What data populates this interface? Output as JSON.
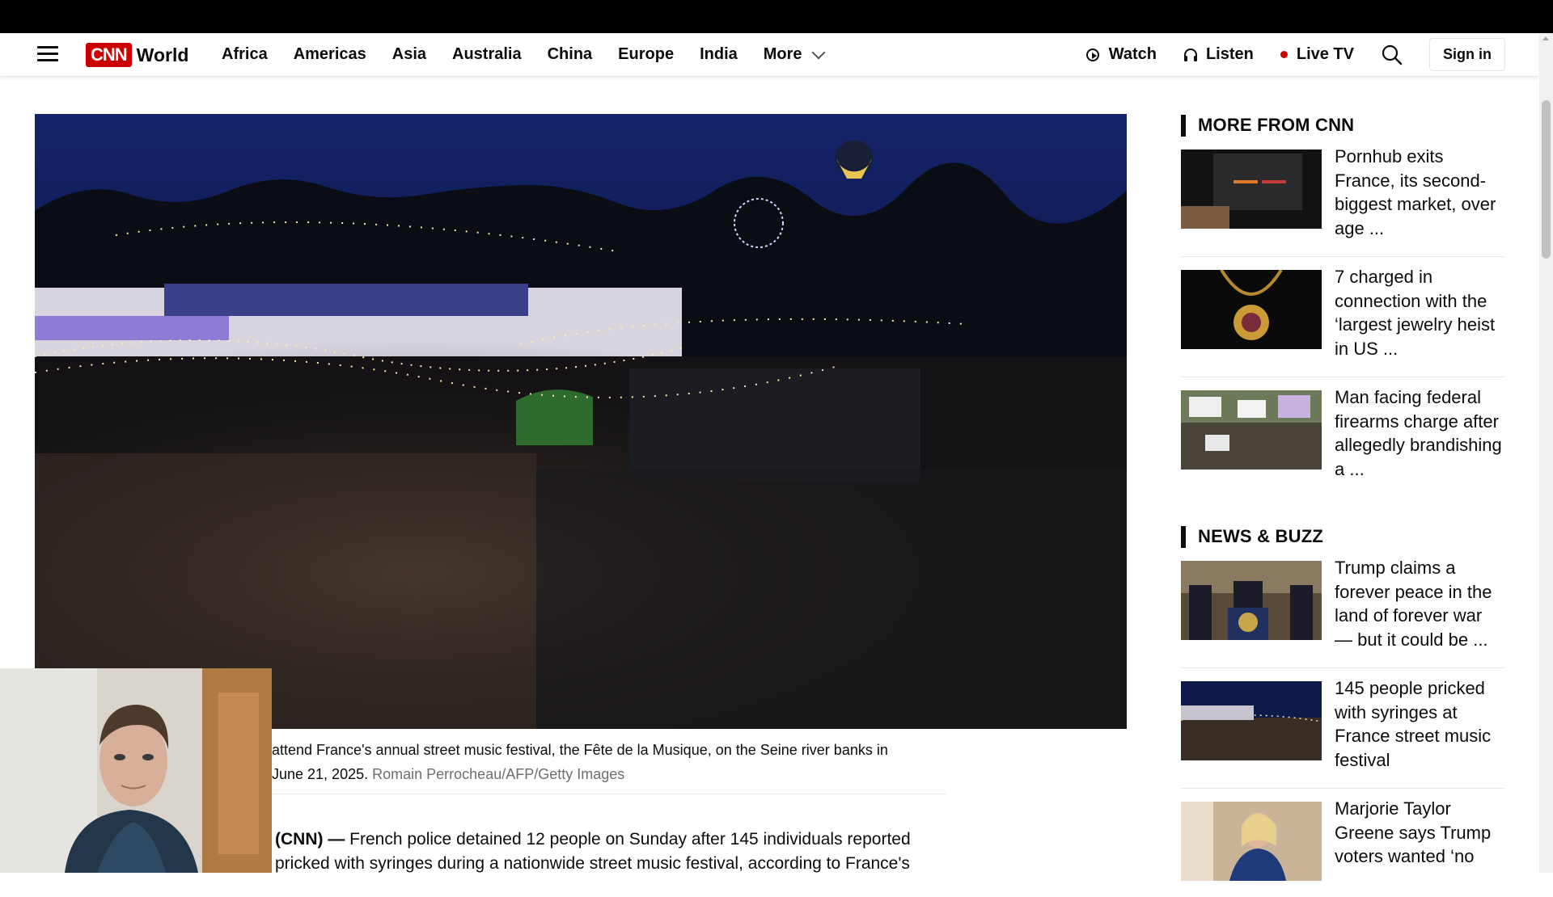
{
  "nav": {
    "brand_logo": "CNN",
    "brand_section": "World",
    "links": [
      "Africa",
      "Americas",
      "Asia",
      "Australia",
      "China",
      "Europe",
      "India"
    ],
    "more_label": "More",
    "watch_label": "Watch",
    "listen_label": "Listen",
    "live_tv_label": "Live TV",
    "sign_in_label": "Sign in"
  },
  "article": {
    "caption_line1": "attend France's annual street music festival, the Fête de la Musique, on the Seine river banks in",
    "caption_line2_start": "June 21, 2025.",
    "caption_credit": "Romain Perrocheau/AFP/Getty Images",
    "dateline": "(CNN) —",
    "body_line1": "French police detained 12 people on Sunday after 145 individuals reported",
    "body_line2": "pricked with syringes during a nationwide street music festival, according to France's"
  },
  "sidebar": {
    "more_from_cnn": {
      "heading": "MORE FROM CNN",
      "items": [
        {
          "title": "Pornhub exits France, its second-biggest market, over age ..."
        },
        {
          "title": "7 charged in connection with the ‘largest jewelry heist in US ..."
        },
        {
          "title": "Man facing federal firearms charge after allegedly brandishing a ..."
        }
      ]
    },
    "news_buzz": {
      "heading": "NEWS & BUZZ",
      "items": [
        {
          "title": "Trump claims a forever peace in the land of forever war — but it could be ..."
        },
        {
          "title": "145 people pricked with syringes at France street music festival"
        },
        {
          "title": "Marjorie Taylor Greene says Trump voters wanted ‘no"
        }
      ]
    }
  },
  "colors": {
    "brand_red": "#cc0000",
    "text": "#0c0c0c",
    "credit_gray": "#6e6e6e"
  }
}
